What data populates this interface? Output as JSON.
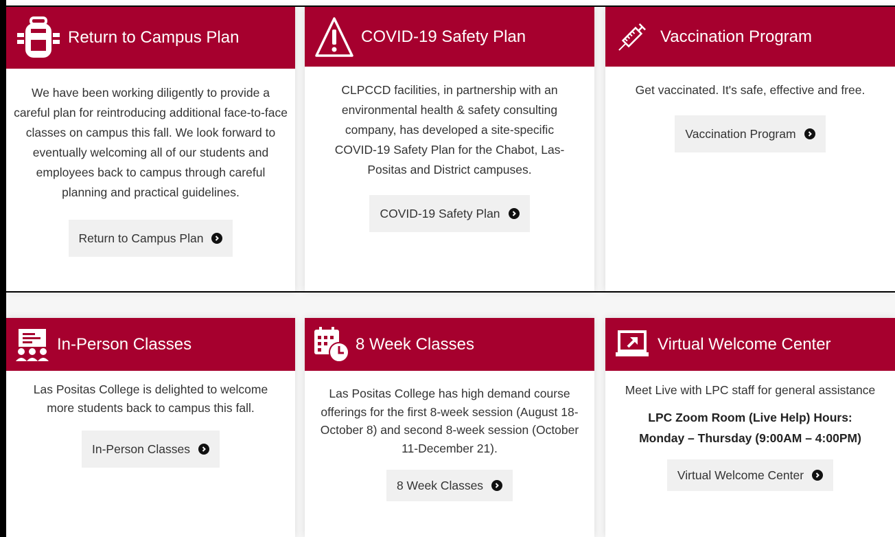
{
  "cards": [
    {
      "title": "Return to Campus Plan",
      "icon": "backpack-icon",
      "body": "We have been working diligently to provide a careful plan for reintroducing additional face-to-face classes on campus this fall. We look forward to eventually welcoming all of our students and employees back to campus through careful planning and practical guidelines.",
      "button": "Return to Campus Plan"
    },
    {
      "title": "COVID-19 Safety Plan",
      "icon": "warning-icon",
      "body": "CLPCCD facilities, in partnership with an environmental health & safety consulting company, has developed a site-specific COVID-19 Safety Plan for the Chabot, Las-Positas and District campuses.",
      "button": "COVID-19 Safety Plan"
    },
    {
      "title": "Vaccination Program",
      "icon": "syringe-icon",
      "body": "Get vaccinated. It's safe, effective and free.",
      "button": "Vaccination Program"
    },
    {
      "title": "In-Person Classes",
      "icon": "classroom-icon",
      "body": "Las Positas College is delighted to welcome more students back to campus this fall.",
      "button": "In-Person Classes"
    },
    {
      "title": "8 Week Classes",
      "icon": "calendar-clock-icon",
      "body": "Las Positas College has high demand course offerings for the first 8-week session (August 18-October 8) and second 8-week session (October 11-December 21).",
      "button": "8 Week Classes"
    },
    {
      "title": "Virtual Welcome Center",
      "icon": "laptop-arrow-icon",
      "body": "Meet Live with LPC staff for general assistance",
      "hours_line1": "LPC Zoom Room (Live Help) Hours:",
      "hours_line2": "Monday – Thursday (9:00AM – 4:00PM)",
      "button": "Virtual Welcome Center"
    }
  ],
  "colors": {
    "header": "#a6002e",
    "button_bg": "#f0f0f0",
    "text": "#333333"
  }
}
